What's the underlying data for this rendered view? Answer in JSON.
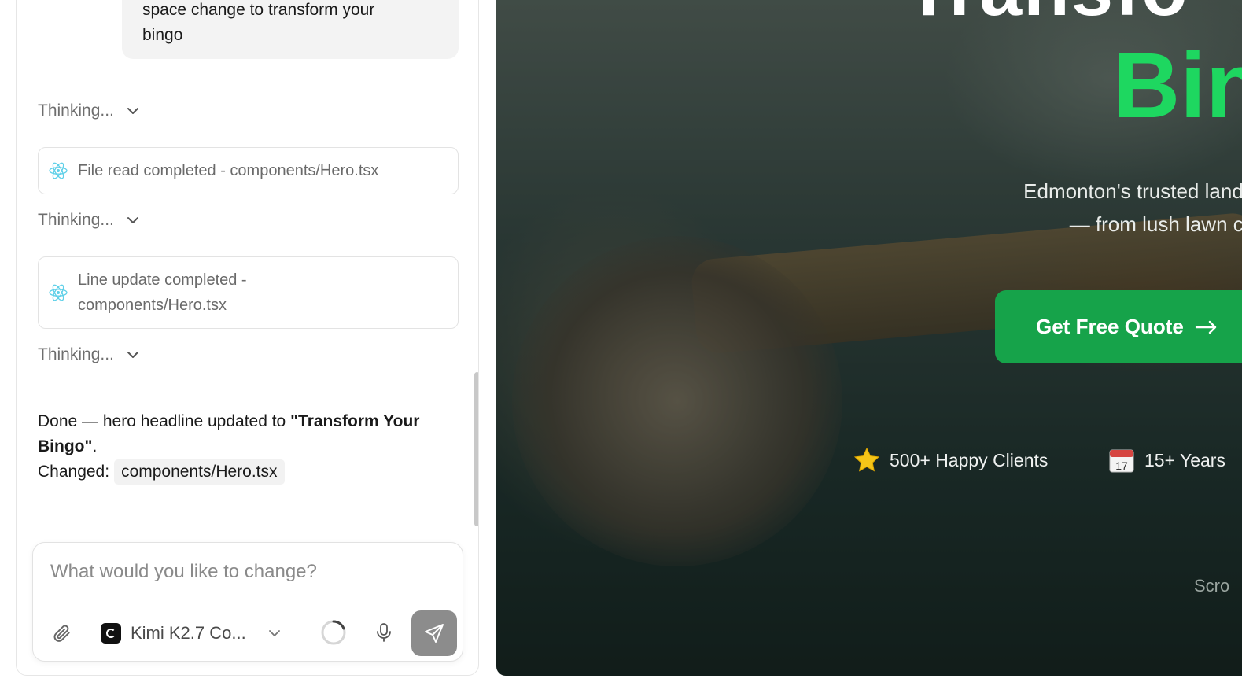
{
  "chat": {
    "user_message_lines": [
      "space change to transform your",
      "bingo"
    ],
    "thinking_label": "Thinking...",
    "tool_events": [
      {
        "label": "File read completed - components/Hero.tsx"
      },
      {
        "label_line1": "Line update completed -",
        "label_line2": "components/Hero.tsx"
      }
    ],
    "assistant": {
      "prefix": "Done — hero headline updated to ",
      "headline_bold": "\"Transform Your Bingo\"",
      "suffix": ".",
      "changed_label": "Changed:",
      "changed_file": "components/Hero.tsx"
    }
  },
  "composer": {
    "placeholder": "What would you like to change?",
    "model_name": "Kimi K2.7 Co..."
  },
  "preview": {
    "hero_title_top": "Transfo",
    "hero_title_green": "Bin",
    "subtitle_line1": "Edmonton's trusted landscaping experts de",
    "subtitle_line2": "— from lush lawn care to full landscap",
    "cta_label": "Get Free Quote",
    "stats": [
      {
        "icon": "star-icon",
        "label": "500+ Happy Clients"
      },
      {
        "icon": "calendar-icon",
        "label": "15+ Years"
      }
    ],
    "scroll_hint": "Scro",
    "colors": {
      "accent_green": "#1ed760",
      "cta_green": "#16a34a",
      "send_button": "#8c8c8c"
    }
  }
}
